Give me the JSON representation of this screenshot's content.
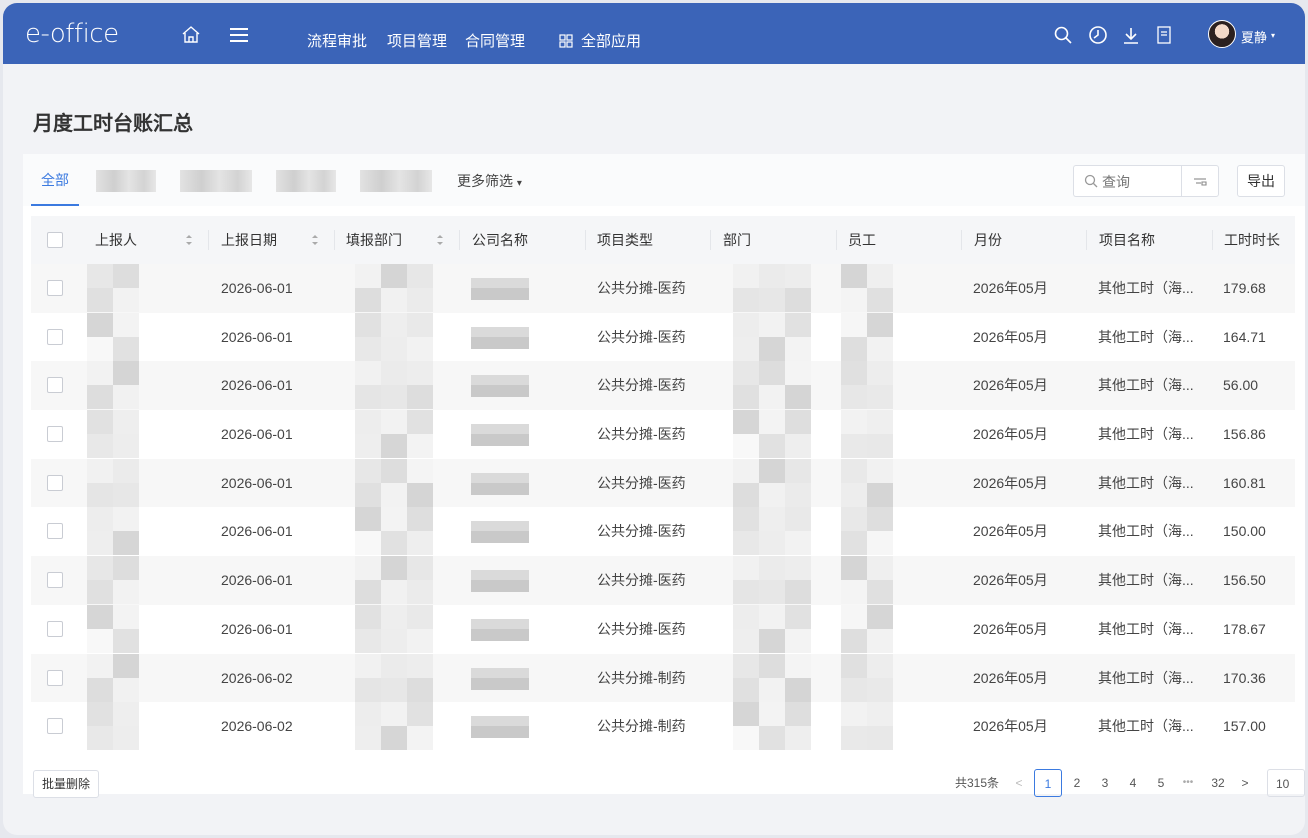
{
  "app": {
    "logo": "e-office",
    "nav": [
      "流程审批",
      "项目管理",
      "合同管理"
    ],
    "all_apps": "全部应用",
    "user": "夏静"
  },
  "page": {
    "title": "月度工时台账汇总"
  },
  "filters": {
    "tab_all": "全部",
    "more_filters": "更多筛选",
    "search_placeholder": "查询",
    "export": "导出"
  },
  "table": {
    "columns": [
      "上报人",
      "上报日期",
      "填报部门",
      "公司名称",
      "项目类型",
      "部门",
      "员工",
      "月份",
      "项目名称",
      "工时时长"
    ],
    "rows": [
      {
        "date": "2026-06-01",
        "type": "公共分摊-医药",
        "month": "2026年05月",
        "project": "其他工时（海...",
        "hours": "179.68"
      },
      {
        "date": "2026-06-01",
        "type": "公共分摊-医药",
        "month": "2026年05月",
        "project": "其他工时（海...",
        "hours": "164.71"
      },
      {
        "date": "2026-06-01",
        "type": "公共分摊-医药",
        "month": "2026年05月",
        "project": "其他工时（海...",
        "hours": "56.00"
      },
      {
        "date": "2026-06-01",
        "type": "公共分摊-医药",
        "month": "2026年05月",
        "project": "其他工时（海...",
        "hours": "156.86"
      },
      {
        "date": "2026-06-01",
        "type": "公共分摊-医药",
        "month": "2026年05月",
        "project": "其他工时（海...",
        "hours": "160.81"
      },
      {
        "date": "2026-06-01",
        "type": "公共分摊-医药",
        "month": "2026年05月",
        "project": "其他工时（海...",
        "hours": "150.00"
      },
      {
        "date": "2026-06-01",
        "type": "公共分摊-医药",
        "month": "2026年05月",
        "project": "其他工时（海...",
        "hours": "156.50"
      },
      {
        "date": "2026-06-01",
        "type": "公共分摊-医药",
        "month": "2026年05月",
        "project": "其他工时（海...",
        "hours": "178.67"
      },
      {
        "date": "2026-06-02",
        "type": "公共分摊-制药",
        "month": "2026年05月",
        "project": "其他工时（海...",
        "hours": "170.36"
      },
      {
        "date": "2026-06-02",
        "type": "公共分摊-制药",
        "month": "2026年05月",
        "project": "其他工时（海...",
        "hours": "157.00"
      }
    ]
  },
  "footer": {
    "batch_delete": "批量删除",
    "total": "共315条",
    "pages": [
      "1",
      "2",
      "3",
      "4",
      "5",
      "•••",
      "32"
    ],
    "current_page": "1",
    "prev": "<",
    "next": ">",
    "page_size": "10"
  },
  "colors": {
    "topbar": "#3b64b8",
    "accent": "#3b7ae0"
  },
  "icons": {
    "home": "home-icon",
    "menu": "menu-icon",
    "grid": "grid-icon",
    "search": "search-icon",
    "clock": "clock-icon",
    "download": "download-icon",
    "document": "document-icon",
    "sort": "sort-icon",
    "filter": "filter-icon"
  }
}
